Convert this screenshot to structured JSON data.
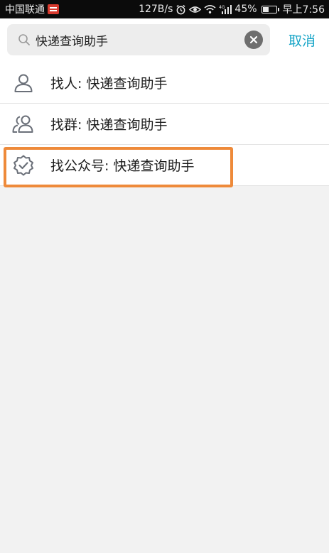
{
  "status_bar": {
    "carrier": "中国联通",
    "net_speed": "127B/s",
    "battery_percent": "45%",
    "time": "早上7:56",
    "icons": [
      "carrier-badge-icon",
      "alarm-icon",
      "eye-icon",
      "wifi-icon",
      "signal-icon",
      "battery-icon"
    ]
  },
  "search": {
    "query": "快递查询助手",
    "cancel_label": "取消"
  },
  "results": [
    {
      "label": "找人: 快递查询助手",
      "icon": "person-icon"
    },
    {
      "label": "找群: 快递查询助手",
      "icon": "group-icon"
    },
    {
      "label": "找公众号: 快递查询助手",
      "icon": "official-account-badge-icon"
    }
  ],
  "colors": {
    "accent": "#1aa6c8",
    "highlight": "#ee8a3a",
    "status_bar_bg": "#0b0b0b",
    "page_bg": "#f2f2f2"
  }
}
